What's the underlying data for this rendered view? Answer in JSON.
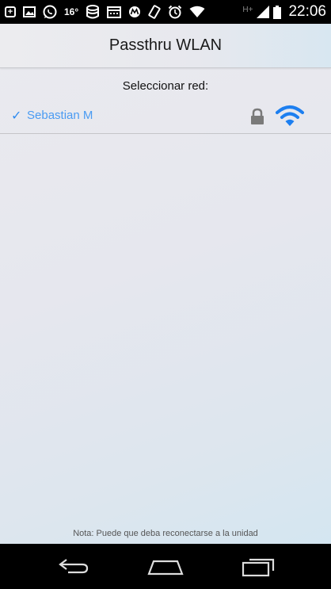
{
  "status_bar": {
    "icons": [
      "plus-box-icon",
      "image-icon",
      "whatsapp-icon",
      "temperature",
      "database-icon",
      "calendar-icon",
      "motorola-icon",
      "vibrate-icon",
      "alarm-icon",
      "wifi-icon",
      "h-plus-label",
      "signal-icon",
      "battery-icon"
    ],
    "temperature": "16°",
    "network_type": "H+",
    "time": "22:06"
  },
  "header": {
    "title": "Passthru WLAN"
  },
  "network_list": {
    "label": "Seleccionar red:",
    "items": [
      {
        "name": "Sebastian M",
        "selected": true,
        "check": "✓",
        "locked": true,
        "signal": "full"
      }
    ]
  },
  "footer": {
    "note": "Nota: Puede que deba reconectarse a la unidad"
  },
  "colors": {
    "accent": "#2f8bf0",
    "wifi": "#1d7ff0",
    "lock": "#7a7a7a"
  },
  "nav_bar": {
    "buttons": [
      "back-icon",
      "home-icon",
      "recent-apps-icon"
    ]
  }
}
